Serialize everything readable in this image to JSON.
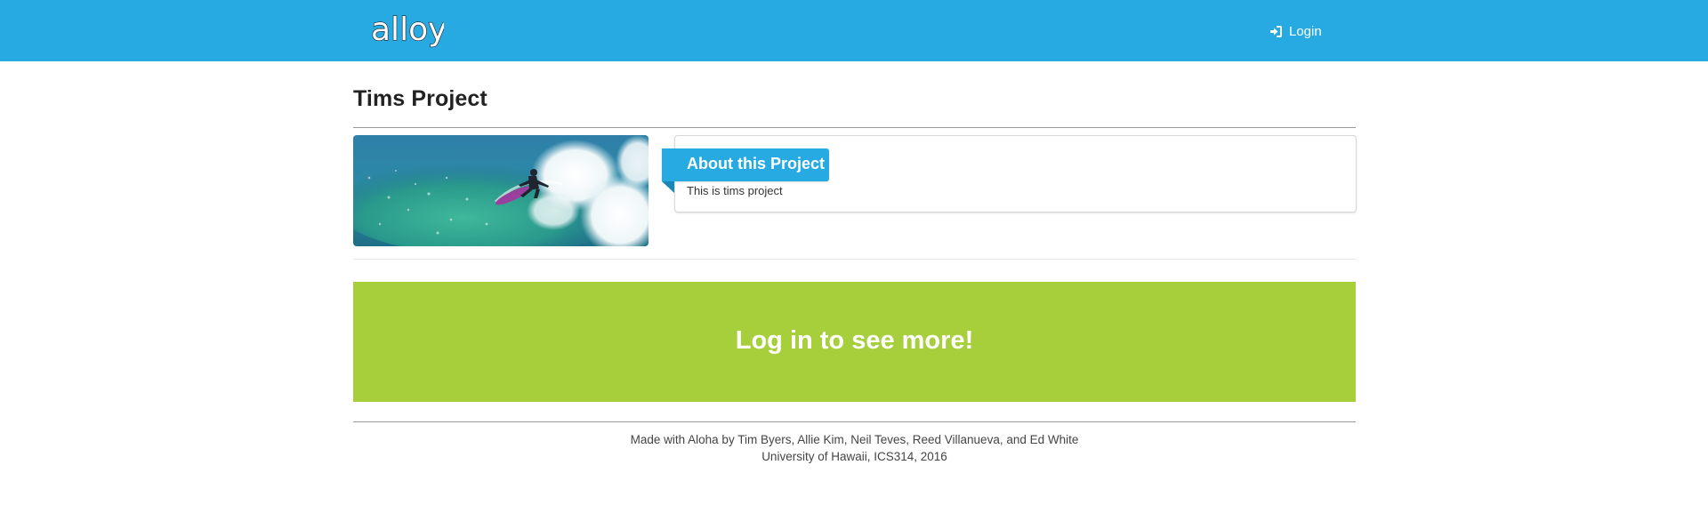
{
  "navbar": {
    "brand": "alloy",
    "login_label": "Login",
    "colors": {
      "background": "#27a9e1",
      "text": "#ffffff"
    }
  },
  "page": {
    "title": "Tims Project"
  },
  "project": {
    "image": "surfer-riding-wave-photo",
    "about_heading": "About this Project",
    "about_text": "This is tims project"
  },
  "cta": {
    "label": "Log in to see more!",
    "color": "#a6cf3b"
  },
  "footer": {
    "line1": "Made with Aloha by Tim Byers, Allie Kim, Neil Teves, Reed Villanueva, and Ed White",
    "line2": "University of Hawaii, ICS314, 2016"
  },
  "icons": {
    "login": "sign-in-icon"
  }
}
